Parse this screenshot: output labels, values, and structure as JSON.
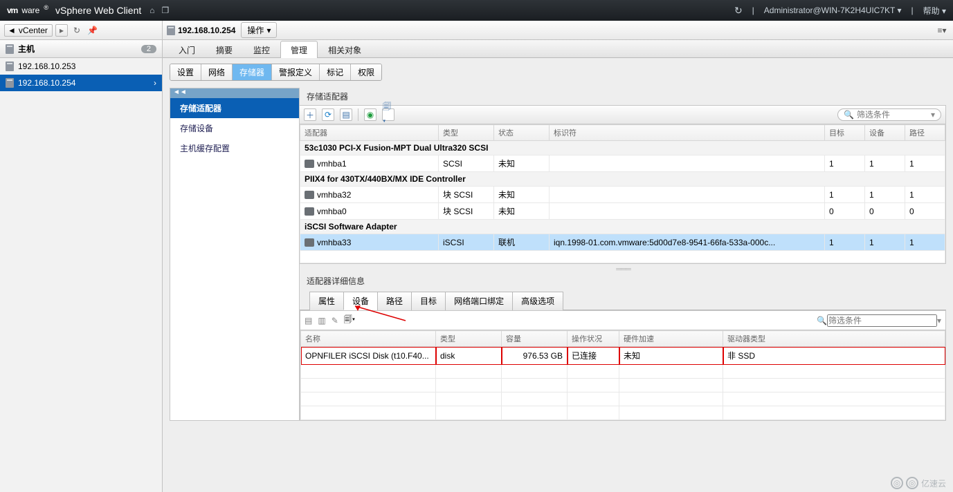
{
  "topbar": {
    "brand_vm": "vm",
    "brand_ware": "ware",
    "brand_reg": "®",
    "product": "vSphere Web Client",
    "user": "Administrator@WIN-7K2H4UIC7KT",
    "help": "帮助"
  },
  "sidebar": {
    "back_label": "vCenter",
    "section_title": "主机",
    "section_badge": "2",
    "hosts": [
      "192.168.10.253",
      "192.168.10.254"
    ],
    "selected_index": 1
  },
  "object": {
    "name": "192.168.10.254",
    "actions_label": "操作"
  },
  "tabs1": {
    "items": [
      "入门",
      "摘要",
      "监控",
      "管理",
      "相关对象"
    ],
    "active_index": 3
  },
  "subtabs": {
    "items": [
      "设置",
      "网络",
      "存储器",
      "警报定义",
      "标记",
      "权限"
    ],
    "active_index": 2
  },
  "leftnav": {
    "items": [
      "存储适配器",
      "存储设备",
      "主机缓存配置"
    ],
    "selected_index": 0
  },
  "adapters": {
    "section_title": "存储适配器",
    "filter_placeholder": "筛选条件",
    "columns": [
      "适配器",
      "类型",
      "状态",
      "标识符",
      "目标",
      "设备",
      "路径"
    ],
    "groups": [
      {
        "label": "53c1030 PCI-X Fusion-MPT Dual Ultra320 SCSI",
        "rows": [
          {
            "adapter": "vmhba1",
            "type": "SCSI",
            "status": "未知",
            "identifier": "",
            "targets": "1",
            "devices": "1",
            "paths": "1"
          }
        ]
      },
      {
        "label": "PIIX4 for 430TX/440BX/MX IDE Controller",
        "rows": [
          {
            "adapter": "vmhba32",
            "type": "块 SCSI",
            "status": "未知",
            "identifier": "",
            "targets": "1",
            "devices": "1",
            "paths": "1"
          },
          {
            "adapter": "vmhba0",
            "type": "块 SCSI",
            "status": "未知",
            "identifier": "",
            "targets": "0",
            "devices": "0",
            "paths": "0"
          }
        ]
      },
      {
        "label": "iSCSI Software Adapter",
        "rows": [
          {
            "adapter": "vmhba33",
            "type": "iSCSI",
            "status": "联机",
            "identifier": "iqn.1998-01.com.vmware:5d00d7e8-9541-66fa-533a-000c...",
            "targets": "1",
            "devices": "1",
            "paths": "1",
            "selected": true
          }
        ]
      }
    ]
  },
  "details": {
    "title": "适配器详细信息",
    "tabs": [
      "属性",
      "设备",
      "路径",
      "目标",
      "网络端口绑定",
      "高级选项"
    ],
    "active_index": 1,
    "filter_placeholder": "筛选条件",
    "columns": [
      "名称",
      "类型",
      "容量",
      "操作状况",
      "硬件加速",
      "驱动器类型"
    ],
    "rows": [
      {
        "name": "OPNFILER iSCSI Disk (t10.F40...",
        "type": "disk",
        "capacity": "976.53 GB",
        "op": "已连接",
        "hw": "未知",
        "drive": "非 SSD"
      }
    ]
  },
  "watermark": "亿速云"
}
